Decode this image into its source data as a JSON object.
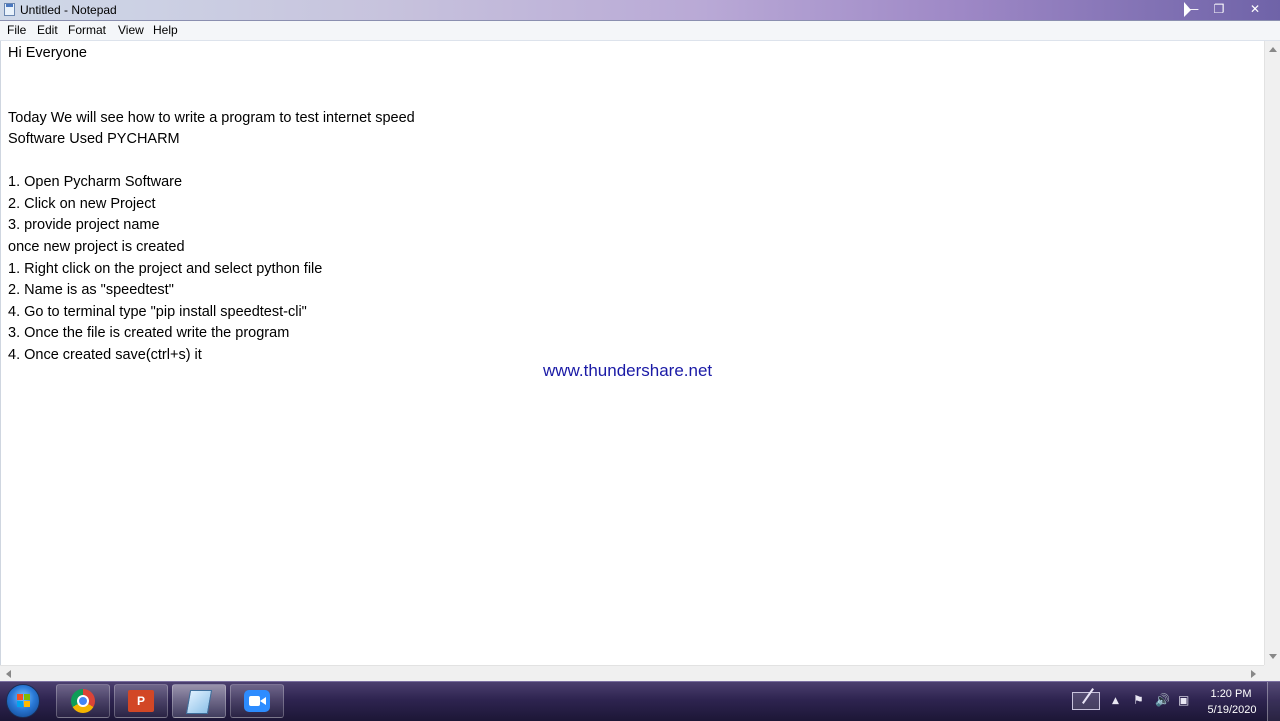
{
  "window": {
    "title": "Untitled - Notepad",
    "controls": {
      "minimize": "—",
      "maximize": "❐",
      "close": "✕"
    }
  },
  "menu": {
    "file": "File",
    "edit": "Edit",
    "format": "Format",
    "view": "View",
    "help": "Help"
  },
  "document": {
    "lines": [
      "Hi Everyone",
      "",
      "",
      "Today We will see how to write a program to test internet speed",
      "Software Used PYCHARM",
      "",
      "1. Open Pycharm Software",
      "2. Click on new Project",
      "3. provide project name",
      "once new project is created",
      "1. Right click on the project and select python file",
      "2. Name is as \"speedtest\"",
      "4. Go to terminal type \"pip install speedtest-cli\"",
      "3. Once the file is created write the program",
      "4. Once created save(ctrl+s) it"
    ],
    "watermark": "www.thundershare.net"
  },
  "taskbar": {
    "pinned": [
      "chrome-icon",
      "powerpoint-icon",
      "notepad-icon",
      "zoom-icon"
    ],
    "ppt_glyph": "P",
    "tray": {
      "show_hidden": "▲",
      "flag": "⚑",
      "speaker": "🔊",
      "network": "▣"
    },
    "clock": {
      "time": "1:20 PM",
      "date": "5/19/2020"
    }
  },
  "colors": {
    "watermark": "#1a1aa6",
    "titlebar_left": "#cfd9e8",
    "taskbar": "#2e2450"
  }
}
